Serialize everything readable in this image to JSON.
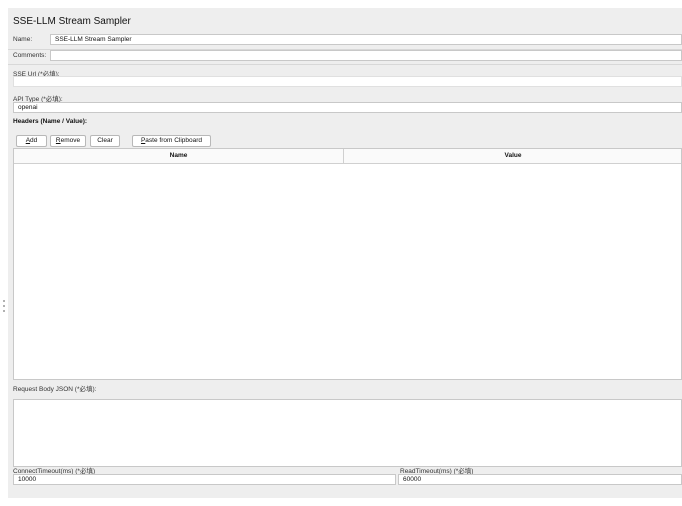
{
  "sampler": {
    "title": "SSE-LLM Stream Sampler",
    "name_label": "Name:",
    "name_value": "SSE-LLM Stream Sampler",
    "comments_label": "Comments:",
    "comments_value": "",
    "sse_url_label": "SSE Url (*必填):",
    "api_type_label": "API Type (*必填):",
    "api_type_value": "openai"
  },
  "headers": {
    "section_label": "Headers (Name / Value):",
    "buttons": {
      "add": {
        "mnemonic": "A",
        "rest": "dd"
      },
      "remove": {
        "mnemonic": "R",
        "rest": "emove"
      },
      "clear": {
        "label": "Clear"
      },
      "paste": {
        "mnemonic": "P",
        "rest": "aste from Clipboard"
      }
    },
    "columns": [
      "Name",
      "Value"
    ],
    "rows": []
  },
  "request_body": {
    "label": "Request Body JSON (*必填):",
    "value": ""
  },
  "timeouts": {
    "connect_label": "ConnectTimeout(ms) (*必填)",
    "connect_value": "10000",
    "read_label": "ReadTimeout(ms) (*必填)",
    "read_value": "60000"
  }
}
